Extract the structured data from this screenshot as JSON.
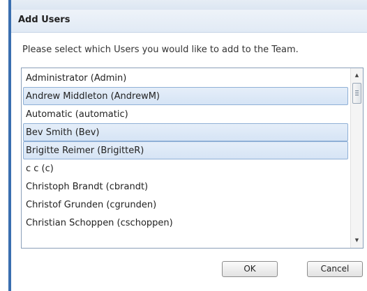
{
  "dialog": {
    "title": "Add Users",
    "instructions": "Please select which Users you would like to add to the Team."
  },
  "users": [
    {
      "label": "Administrator (Admin)",
      "selected": false
    },
    {
      "label": "Andrew Middleton (AndrewM)",
      "selected": true
    },
    {
      "label": "Automatic (automatic)",
      "selected": false
    },
    {
      "label": "Bev Smith (Bev)",
      "selected": true
    },
    {
      "label": "Brigitte Reimer (BrigitteR)",
      "selected": true
    },
    {
      "label": "c c (c)",
      "selected": false
    },
    {
      "label": "Christoph Brandt (cbrandt)",
      "selected": false
    },
    {
      "label": "Christof Grunden (cgrunden)",
      "selected": false
    },
    {
      "label": "Christian Schoppen (cschoppen)",
      "selected": false
    }
  ],
  "scrollbar": {
    "up_icon": "chevron-up-icon",
    "down_icon": "chevron-down-icon",
    "position": 0.05
  },
  "buttons": {
    "ok_label": "OK",
    "cancel_label": "Cancel"
  },
  "colors": {
    "selection_background": "#dbe7f6",
    "selection_border": "#8fb0d6",
    "dialog_accent": "#3a6fb0"
  }
}
